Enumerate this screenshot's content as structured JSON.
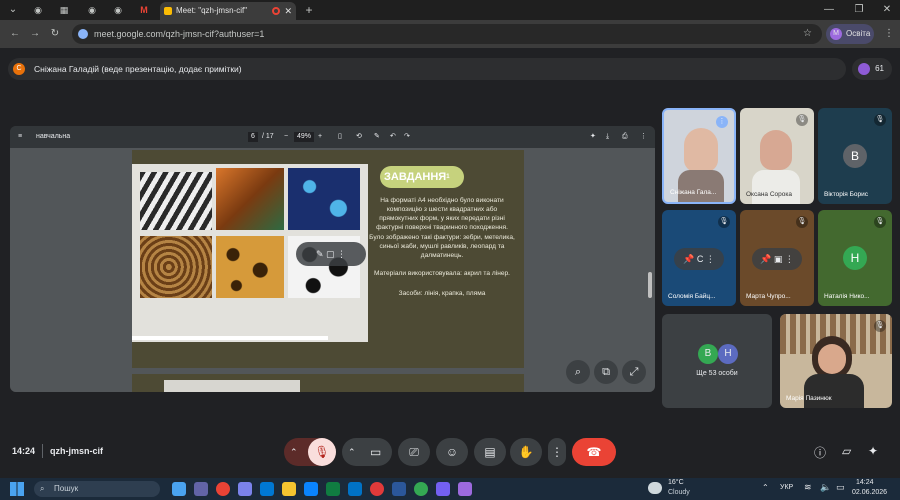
{
  "browser": {
    "tabs": [
      {
        "label": "Meet: \"qzh-jmsn-cif\""
      }
    ],
    "new_tab": "+",
    "url": "meet.google.com/qzh-jmsn-cif?authuser=1",
    "profile_label": "Освіта",
    "profile_initial": "M"
  },
  "meet": {
    "presenter_text": "Сніжана Галадій (веде презентацію, додає примітки)",
    "presenter_initial": "С",
    "people_count": "61",
    "meeting_time": "14:24",
    "meeting_code": "qzh-jmsn-cif",
    "pdf": {
      "file_name": "навчальна",
      "page_current": "6",
      "page_total": "/ 17",
      "zoom": "49%"
    },
    "slide": {
      "title": "ЗАВДАННЯ",
      "title_suffix": "1",
      "paragraph1": "На форматі А4 необхідно було виконати композицію з шести квадратних або прямокутних форм, у яких передати різні фактурні поверхні тваринного походження.",
      "paragraph2": "Було зображено такі фактури: зебри, метелика, синьої жаби, мушлі равликів, леопард та далматинець.",
      "paragraph3": "Матеріали використовувала: акрил та лінер.",
      "paragraph4": "Засоби: лінія, крапка, пляма"
    },
    "participants": [
      {
        "name": "Сніжана Гала...",
        "type": "video"
      },
      {
        "name": "Оксана Сорока",
        "type": "video"
      },
      {
        "name": "Вікторія Борис",
        "initial": "В",
        "type": "avatar"
      },
      {
        "name": "Соломія Байц...",
        "initial": "С",
        "type": "avatar"
      },
      {
        "name": "Марта Чупро...",
        "type": "video"
      },
      {
        "name": "Наталія Нико...",
        "initial": "Н",
        "type": "avatar"
      },
      {
        "name": "Марія Пазинюк",
        "type": "video"
      }
    ],
    "more_people": {
      "label": "Ще 53 особи",
      "initial1": "В",
      "initial2": "Н"
    }
  },
  "taskbar": {
    "search_placeholder": "Пошук",
    "weather_temp": "16°C",
    "weather_desc": "Cloudy",
    "language": "УКР",
    "time": "14:24",
    "date": "02.06.2026"
  },
  "colors": {
    "end_call": "#ea4335",
    "accent": "#8ab4f8",
    "slide_bg": "#4d4a34",
    "title_pill": "#c6d27d"
  }
}
